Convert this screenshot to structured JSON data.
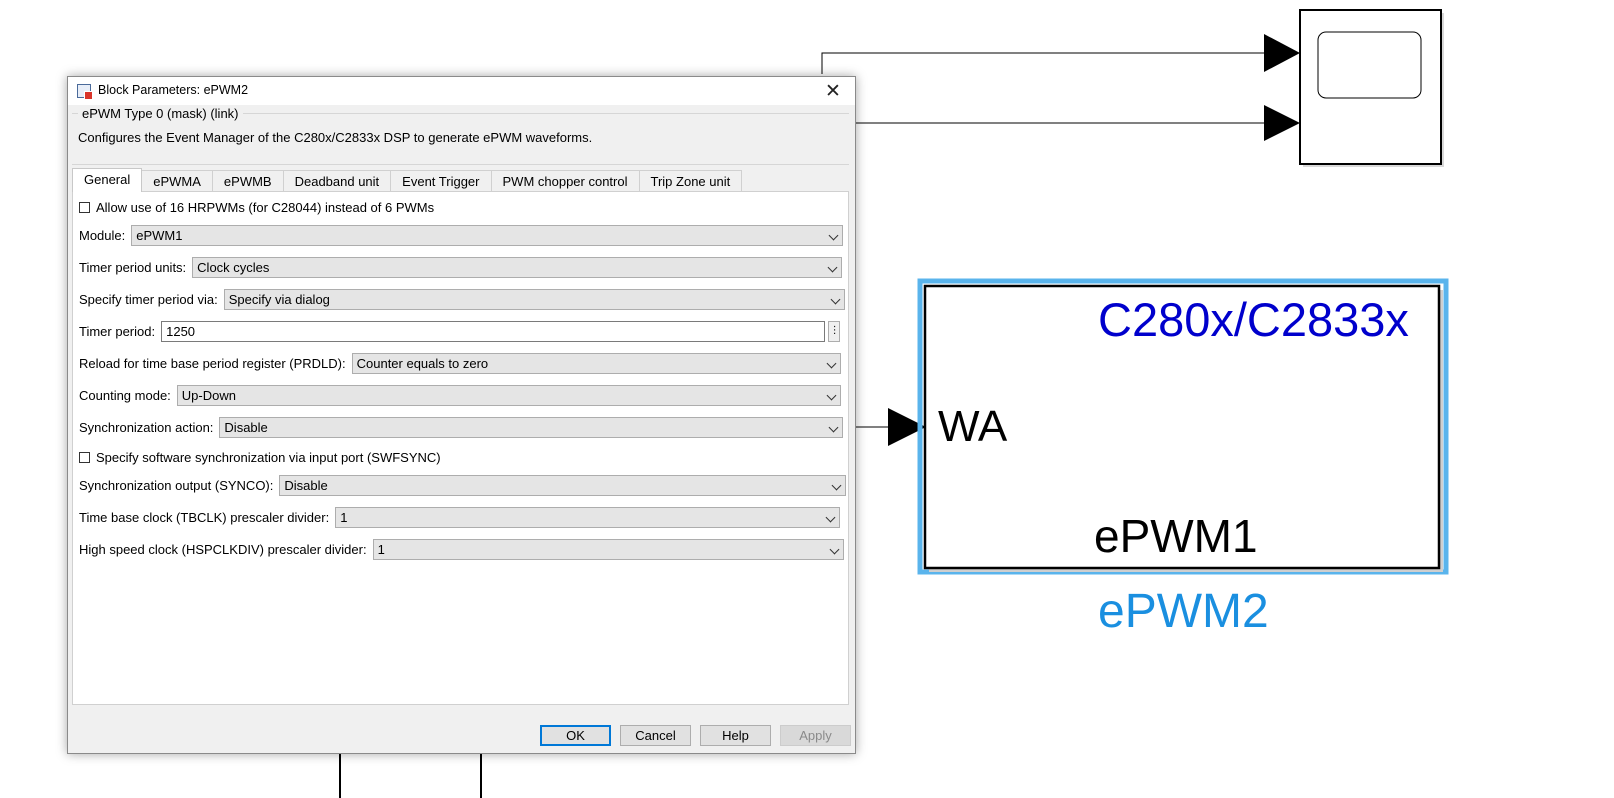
{
  "dialog": {
    "title": "Block Parameters: ePWM2",
    "close_glyph": "✕",
    "mask_type": "ePWM Type 0 (mask) (link)",
    "description": "Configures the Event Manager of the C280x/C2833x DSP to generate ePWM waveforms.",
    "tabs": [
      "General",
      "ePWMA",
      "ePWMB",
      "Deadband unit",
      "Event Trigger",
      "PWM chopper control",
      "Trip Zone unit"
    ],
    "active_tab": "General",
    "general": {
      "hrpwm_checkbox_label": "Allow use of 16 HRPWMs (for C28044) instead of 6 PWMs",
      "hrpwm_checked": false,
      "module_label": "Module:",
      "module_value": "ePWM1",
      "timer_units_label": "Timer period units:",
      "timer_units_value": "Clock cycles",
      "timer_via_label": "Specify timer period via:",
      "timer_via_value": "Specify via dialog",
      "timer_period_label": "Timer period:",
      "timer_period_value": "1250",
      "timer_period_dots": "⋮",
      "prdld_label": "Reload for time base period register (PRDLD):",
      "prdld_value": "Counter equals to zero",
      "counting_mode_label": "Counting mode:",
      "counting_mode_value": "Up-Down",
      "sync_action_label": "Synchronization action:",
      "sync_action_value": "Disable",
      "swfsync_checkbox_label": "Specify software synchronization via input port (SWFSYNC)",
      "swfsync_checked": false,
      "synco_label": "Synchronization output (SYNCO):",
      "synco_value": "Disable",
      "tbclk_label": "Time base clock (TBCLK) prescaler divider:",
      "tbclk_value": "1",
      "hspclkdiv_label": "High speed clock (HSPCLKDIV) prescaler divider:",
      "hspclkdiv_value": "1"
    },
    "buttons": {
      "ok": "OK",
      "cancel": "Cancel",
      "help": "Help",
      "apply": "Apply"
    }
  },
  "canvas": {
    "epwm_block": {
      "target_text": "C280x/C2833x",
      "input_port": "WA",
      "module_text": "ePWM1",
      "name": "ePWM2"
    },
    "colors": {
      "selection": "#5ab4ec",
      "target_text": "#0000cc",
      "block_name": "#1a8fe0"
    }
  }
}
